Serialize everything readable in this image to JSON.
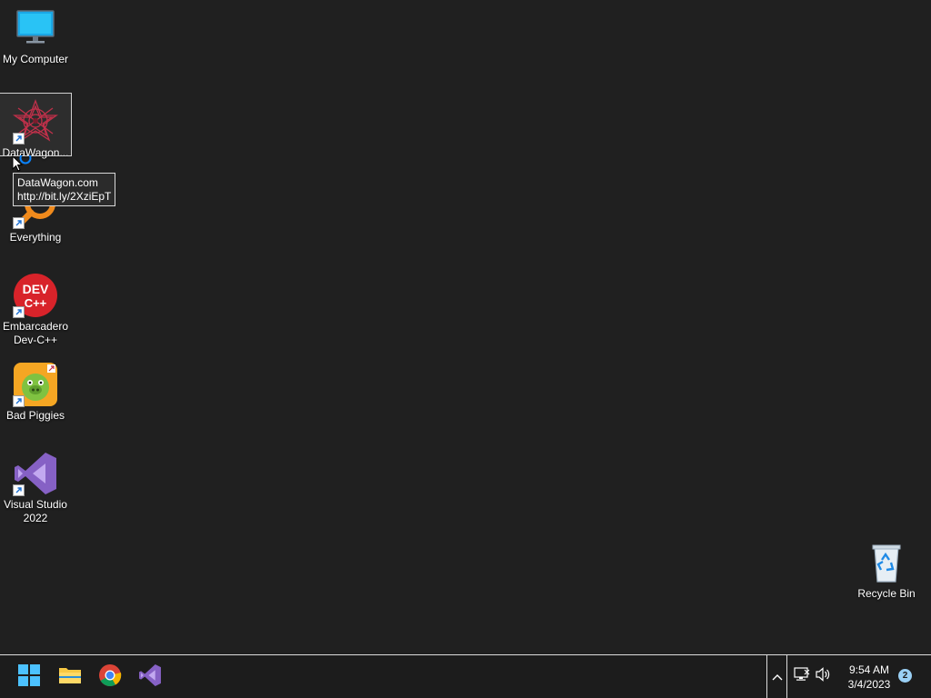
{
  "desktop": {
    "icons": [
      {
        "label": "My Computer",
        "icon": "computer-icon",
        "shortcut": false
      },
      {
        "label": "DataWagon...",
        "icon": "datawagon-icon",
        "shortcut": true,
        "selected": true
      },
      {
        "label": "Everything",
        "icon": "everything-search-icon",
        "shortcut": true
      },
      {
        "label": "Embarcadero Dev-C++",
        "icon": "devcpp-icon",
        "shortcut": true
      },
      {
        "label": "Bad Piggies",
        "icon": "bad-piggies-icon",
        "shortcut": true
      },
      {
        "label": "Visual Studio 2022",
        "icon": "visual-studio-icon",
        "shortcut": true
      },
      {
        "label": "Recycle Bin",
        "icon": "recycle-bin-icon",
        "shortcut": false
      }
    ],
    "devcpp_icon_text": {
      "line1": "DEV",
      "line2": "C++"
    }
  },
  "tooltip": {
    "line1": "DataWagon.com",
    "line2": "http://bit.ly/2XziEpT"
  },
  "taskbar": {
    "pinned": [
      {
        "name": "start-button",
        "icon": "windows-logo-icon"
      },
      {
        "name": "file-explorer-button",
        "icon": "folder-icon"
      },
      {
        "name": "chrome-button",
        "icon": "chrome-icon"
      },
      {
        "name": "visual-studio-button",
        "icon": "visual-studio-icon"
      }
    ],
    "tray": {
      "chevron_icon": "chevron-up-icon",
      "network_icon": "network-icon",
      "volume_icon": "volume-icon"
    },
    "clock": {
      "time": "9:54 AM",
      "date": "3/4/2023"
    },
    "notification_count": "2"
  },
  "colors": {
    "desktop_bg": "#202020",
    "taskbar_bg": "#1c1c1c",
    "accent_blue": "#0a84ff",
    "badge": "#9ad0f5"
  }
}
